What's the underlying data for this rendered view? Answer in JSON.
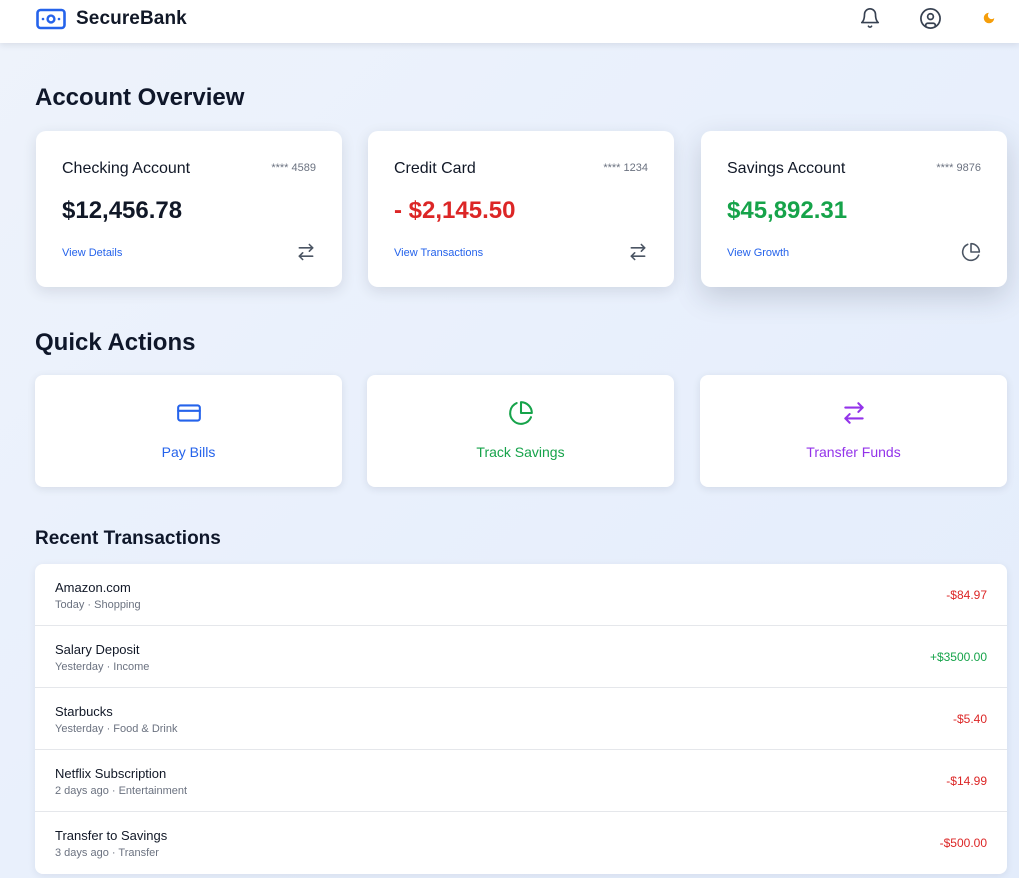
{
  "app": {
    "name": "SecureBank",
    "logo_icon": "banknote-icon",
    "header_icons": [
      "bell-icon",
      "user-circle-icon",
      "moon-icon"
    ]
  },
  "colors": {
    "brand_blue": "#2563eb",
    "negative_red": "#dc2626",
    "positive_green": "#16a34a",
    "transfer_purple": "#9333ea",
    "moon_amber": "#f59e0b"
  },
  "overview": {
    "title": "Account Overview",
    "accounts": [
      {
        "name": "Checking Account",
        "mask": "**** 4589",
        "balance": "$12,456.78",
        "link": "View Details",
        "icon": "transfer-arrows-icon",
        "balance_color": "#111827"
      },
      {
        "name": "Credit Card",
        "mask": "**** 1234",
        "balance": "- $2,145.50",
        "link": "View Transactions",
        "icon": "transfer-arrows-icon",
        "balance_color": "#dc2626"
      },
      {
        "name": "Savings Account",
        "mask": "**** 9876",
        "balance": "$45,892.31",
        "link": "View Growth",
        "icon": "pie-chart-icon",
        "balance_color": "#16a34a"
      }
    ]
  },
  "quick_actions": {
    "title": "Quick Actions",
    "items": [
      {
        "label": "Pay Bills",
        "icon": "credit-card-icon",
        "color": "#2563eb"
      },
      {
        "label": "Track Savings",
        "icon": "pie-chart-icon",
        "color": "#16a34a"
      },
      {
        "label": "Transfer Funds",
        "icon": "transfer-arrows-icon",
        "color": "#9333ea"
      }
    ]
  },
  "recent": {
    "title": "Recent Transactions",
    "transactions": [
      {
        "name": "Amazon.com",
        "meta": "Today · Shopping",
        "amount": "-$84.97",
        "type": "debit"
      },
      {
        "name": "Salary Deposit",
        "meta": "Yesterday · Income",
        "amount": "+$3500.00",
        "type": "credit"
      },
      {
        "name": "Starbucks",
        "meta": "Yesterday · Food & Drink",
        "amount": "-$5.40",
        "type": "debit"
      },
      {
        "name": "Netflix Subscription",
        "meta": "2 days ago · Entertainment",
        "amount": "-$14.99",
        "type": "debit"
      },
      {
        "name": "Transfer to Savings",
        "meta": "3 days ago · Transfer",
        "amount": "-$500.00",
        "type": "debit"
      }
    ]
  }
}
